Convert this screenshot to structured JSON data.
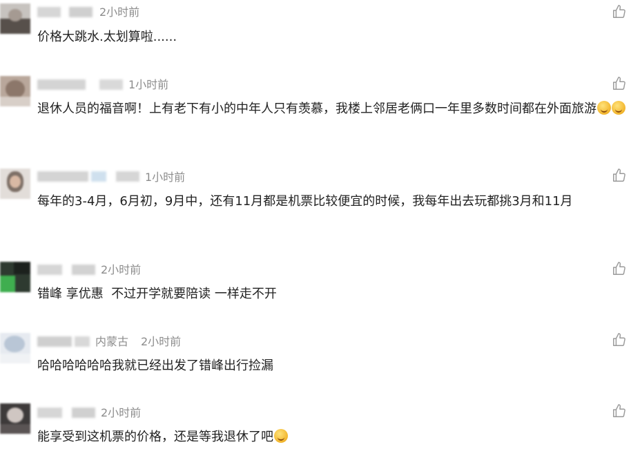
{
  "comments": [
    {
      "location": "",
      "time": "2小时前",
      "text": "价格大跳水.太划算啦......",
      "emojis": [],
      "like_icon": "thumbs-up-icon"
    },
    {
      "location": "",
      "time": "1小时前",
      "text": "退休人员的福音啊！上有老下有小的中年人只有羡慕，我楼上邻居老俩口一年里多数时间都在外面旅游",
      "emojis": [
        "laughing-emoji",
        "laughing-emoji"
      ],
      "like_icon": "thumbs-up-icon"
    },
    {
      "location": "",
      "time": "1小时前",
      "text": "每年的3-4月，6月初，9月中，还有11月都是机票比较便宜的时候，我每年出去玩都挑3月和11月",
      "emojis": [],
      "like_icon": "thumbs-up-icon"
    },
    {
      "location": "",
      "time": "2小时前",
      "text": "错峰 享优惠  不过开学就要陪读 一样走不开",
      "emojis": [],
      "like_icon": "thumbs-up-icon"
    },
    {
      "location": "内蒙古",
      "time": "2小时前",
      "text": "哈哈哈哈哈哈我就已经出发了错峰出行捡漏",
      "emojis": [],
      "like_icon": "thumbs-up-icon"
    },
    {
      "location": "",
      "time": "2小时前",
      "text": "能享受到这机票的价格，还是等我退休了吧",
      "emojis": [
        "laughing-emoji"
      ],
      "like_icon": "thumbs-up-icon"
    }
  ],
  "colors": {
    "meta_text": "#8c8c8c",
    "body_text": "#222222",
    "like_icon": "#9a9a9a"
  }
}
